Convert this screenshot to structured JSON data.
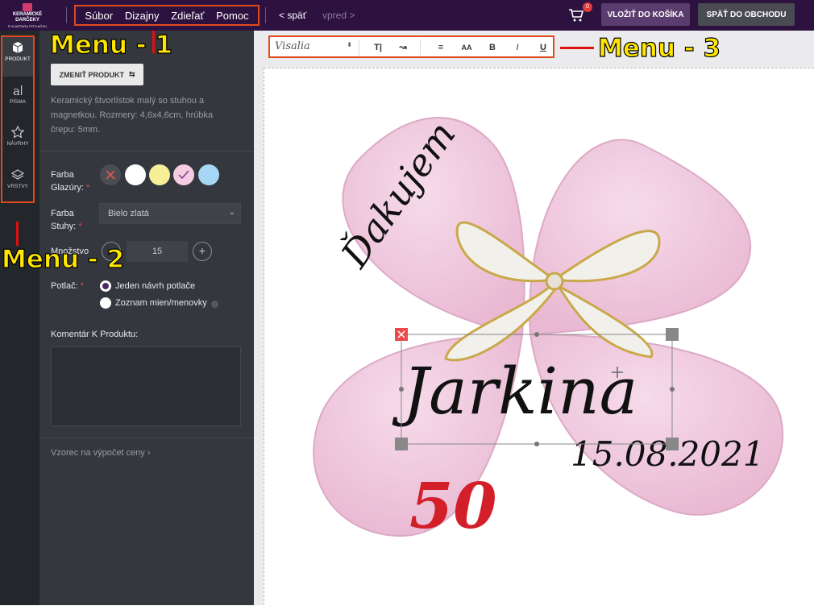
{
  "header": {
    "logo_line1": "KERAMICKÉ DARČEKY",
    "logo_line2": "S VLASTNOU POTLAČOU",
    "menu": [
      "Súbor",
      "Dizajny",
      "Zdieľať",
      "Pomoc"
    ],
    "back": "< späť",
    "forward": "vpred >",
    "cart_count": "0",
    "add_to_cart": "VLOŽIŤ DO KOŠÍKA",
    "back_to_shop": "SPÄŤ DO OBCHODU"
  },
  "iconbar": {
    "items": [
      {
        "label": "PRODUKT",
        "icon": "cube-icon"
      },
      {
        "label": "PÍSMA",
        "icon": "font-icon"
      },
      {
        "label": "NÁVRHY",
        "icon": "star-icon"
      },
      {
        "label": "VRSTVY",
        "icon": "layers-icon"
      }
    ]
  },
  "panel": {
    "change_product": "ZMENIŤ PRODUKT",
    "description": "Keramický štvorlístok malý so stuhou a magnetkou. Rozmery: 4,6x4,6cm, hrúbka črepu: 5mm.",
    "glaze_label_1": "Farba",
    "glaze_label_2": "Glazúry:",
    "glaze_colors": [
      "#ffffff",
      "#f7ee98",
      "#f6cde0",
      "#a8d6f5"
    ],
    "ribbon_label_1": "Farba",
    "ribbon_label_2": "Stuhy:",
    "ribbon_value": "Bielo zlatá",
    "qty_label": "Množstvo",
    "qty_value": "15",
    "print_label": "Potlač:",
    "print_option_1": "Jeden návrh potlače",
    "print_option_2": "Zoznam mien/menovky",
    "comment_label": "Komentár K Produktu:",
    "formula_link": "Vzorec na výpočet ceny"
  },
  "toolbar": {
    "font": "Visalia",
    "buttons": [
      "text-size-icon",
      "curve-text-icon",
      "align-icon",
      "font-case-icon",
      "bold-icon",
      "italic-icon",
      "underline-icon"
    ],
    "bold": "B",
    "italic": "I",
    "underline": "U"
  },
  "design": {
    "word": "Ďakujem",
    "name": "Jarkina",
    "date": "15.08.2021",
    "number": "50",
    "clover_color": "#f1cbe0",
    "number_color": "#d21f2a"
  },
  "annotations": {
    "menu1": "Menu - 1",
    "menu2": "Menu - 2",
    "menu3": "Menu - 3"
  }
}
